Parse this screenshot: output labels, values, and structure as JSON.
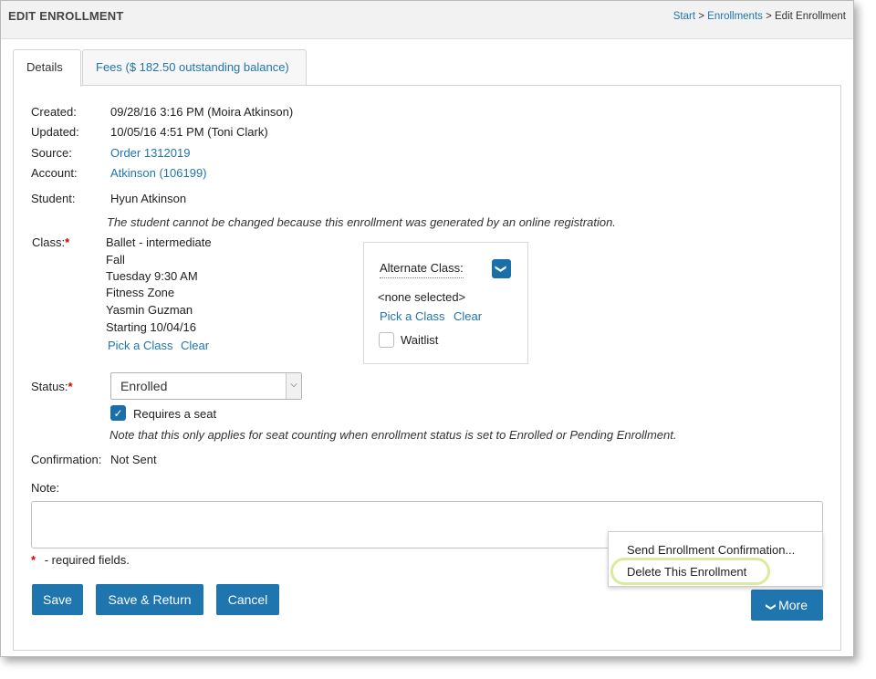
{
  "header": {
    "title": "EDIT ENROLLMENT",
    "breadcrumb": {
      "start": "Start",
      "sep1": ">",
      "enrollments": "Enrollments",
      "sep2": ">",
      "current": "Edit Enrollment"
    }
  },
  "tabs": [
    {
      "label": "Details"
    },
    {
      "label": "Fees ($ 182.50 outstanding balance)"
    }
  ],
  "details": {
    "created_label": "Created:",
    "created_value": "09/28/16 3:16 PM (Moira Atkinson)",
    "updated_label": "Updated:",
    "updated_value": "10/05/16 4:51 PM (Toni Clark)",
    "source_label": "Source:",
    "source_value": "Order 1312019",
    "account_label": "Account:",
    "account_value": "Atkinson (106199)",
    "student_label": "Student:",
    "student_value": "Hyun Atkinson",
    "student_note": "The student cannot be changed because this enrollment was generated by an online registration."
  },
  "class": {
    "label": "Class:",
    "required_mark": "*",
    "lines": [
      "Ballet - intermediate",
      "Fall",
      "Tuesday 9:30 AM",
      "Fitness Zone",
      "Yasmin Guzman",
      "Starting 10/04/16"
    ],
    "pick_label": "Pick a Class",
    "clear_label": "Clear"
  },
  "alternate": {
    "label": "Alternate Class:",
    "selected": "<none selected>",
    "pick_label": "Pick a Class",
    "clear_label": "Clear",
    "waitlist_label": "Waitlist"
  },
  "status": {
    "label": "Status:",
    "required_mark": "*",
    "value": "Enrolled",
    "requires_seat_label": "Requires a seat",
    "seat_note": "Note that this only applies for seat counting when enrollment status is set to Enrolled or Pending Enrollment."
  },
  "confirmation": {
    "label": "Confirmation:",
    "value": "Not Sent"
  },
  "note": {
    "label": "Note:"
  },
  "required_legend": {
    "mark": "*",
    "text": "- required fields."
  },
  "buttons": {
    "save": "Save",
    "save_return": "Save & Return",
    "cancel": "Cancel",
    "more": "More"
  },
  "more_menu": {
    "send_confirmation": "Send Enrollment Confirmation...",
    "delete": "Delete This Enrollment"
  },
  "colors": {
    "accent": "#1f75ae",
    "required": "#d60000",
    "highlight": "#d9ec9c"
  }
}
